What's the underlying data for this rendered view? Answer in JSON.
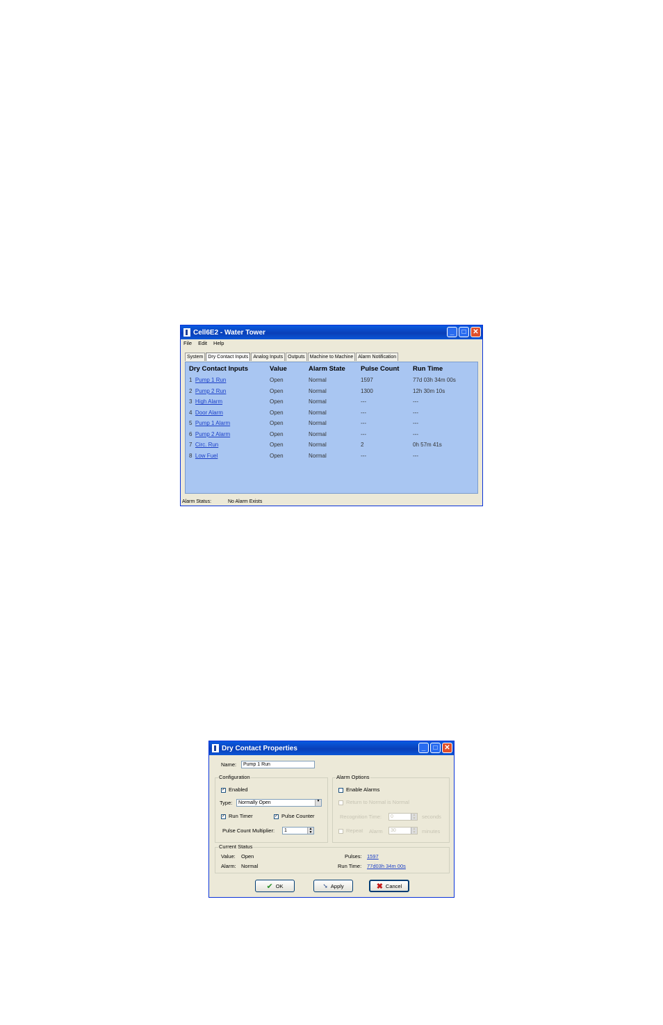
{
  "main_window": {
    "title": "Cell6E2 - Water Tower",
    "menu": [
      "File",
      "Edit",
      "Help"
    ],
    "tabs": [
      "System",
      "Dry Contact Inputs",
      "Analog Inputs",
      "Outputs",
      "Machine to Machine",
      "Alarm Notification"
    ],
    "active_tab": "Dry Contact Inputs",
    "columns": [
      "Dry Contact Inputs",
      "Value",
      "Alarm State",
      "Pulse Count",
      "Run Time"
    ],
    "rows": [
      {
        "num": "1",
        "name": "Pump 1 Run",
        "value": "Open",
        "alarm": "Normal",
        "pulse": "1597",
        "run": "77d 03h 34m 00s"
      },
      {
        "num": "2",
        "name": "Pump 2 Run",
        "value": "Open",
        "alarm": "Normal",
        "pulse": "1300",
        "run": "12h 30m 10s"
      },
      {
        "num": "3",
        "name": "High Alarm",
        "value": "Open",
        "alarm": "Normal",
        "pulse": "---",
        "run": "---"
      },
      {
        "num": "4",
        "name": "Door Alarm",
        "value": "Open",
        "alarm": "Normal",
        "pulse": "---",
        "run": "---"
      },
      {
        "num": "5",
        "name": "Pump 1 Alarm",
        "value": "Open",
        "alarm": "Normal",
        "pulse": "---",
        "run": "---"
      },
      {
        "num": "6",
        "name": "Pump 2 Alarm",
        "value": "Open",
        "alarm": "Normal",
        "pulse": "---",
        "run": "---"
      },
      {
        "num": "7",
        "name": "Circ. Run",
        "value": "Open",
        "alarm": "Normal",
        "pulse": "2",
        "run": "0h 57m 41s"
      },
      {
        "num": "8",
        "name": "Low Fuel",
        "value": "Open",
        "alarm": "Normal",
        "pulse": "---",
        "run": "---"
      }
    ],
    "status_label": "Alarm Status:",
    "status_value": "No Alarm Exists"
  },
  "dialog": {
    "title": "Dry Contact Properties",
    "name_label": "Name:",
    "name_value": "Pump 1 Run",
    "config_title": "Configuration",
    "enabled_label": "Enabled",
    "type_label": "Type:",
    "type_value": "Normally Open",
    "run_timer_label": "Run Timer",
    "pulse_counter_label": "Pulse Counter",
    "multiplier_label": "Pulse Count Multiplier:",
    "multiplier_value": "1",
    "alarm_title": "Alarm Options",
    "enable_alarms_label": "Enable Alarms",
    "return_normal_label": "Return to Normal is Normal",
    "recognition_label": "Recognition Time:",
    "recognition_value": "0",
    "recognition_unit": "seconds",
    "repeat_label": "Repeat",
    "repeat_every": "Alarm",
    "repeat_value": "30",
    "repeat_unit": "minutes",
    "status_title": "Current Status",
    "value_label": "Value:",
    "value_value": "Open",
    "alarm_label": "Alarm:",
    "alarm_value": "Normal",
    "pulses_label": "Pulses:",
    "pulses_value": "1597",
    "runtime_label": "Run Time:",
    "runtime_value": "77d03h 34m 00s",
    "ok_label": "OK",
    "apply_label": "Apply",
    "cancel_label": "Cancel"
  }
}
